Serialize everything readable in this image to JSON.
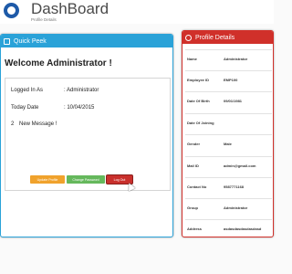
{
  "header": {
    "title": "DashBoard",
    "subtitle": "Profile Details"
  },
  "quick_peek": {
    "title": "Quick Peek",
    "welcome": "Welcome Administrator !",
    "logged_in_label": "Logged In As",
    "logged_in_value": ": Administrator",
    "today_label": "Today Date",
    "today_value": ": 10/04/2015",
    "message_count": "2",
    "message_label": "New Message !",
    "buttons": {
      "update": "Update Profile",
      "password": "Change Password",
      "logout": "Log Out"
    },
    "colors": {
      "accent": "#2aa2d8",
      "update": "#f0a22c",
      "password": "#65b85c",
      "logout": "#c9302c"
    }
  },
  "profile": {
    "title": "Profile Details",
    "accent": "#d0302a",
    "rows": [
      {
        "key": "Name",
        "value": "Administrator"
      },
      {
        "key": "Employee ID",
        "value": "EMP100"
      },
      {
        "key": "Date Of Birth",
        "value": "09/01/1981"
      },
      {
        "key": "Date Of Joining",
        "value": ""
      },
      {
        "key": "Gender",
        "value": "Male"
      },
      {
        "key": "Mail ID",
        "value": "admin@gmail.com"
      },
      {
        "key": "Contact No",
        "value": "9587771168"
      },
      {
        "key": "Group",
        "value": "Administrator"
      },
      {
        "key": "Address",
        "value": "asdasdasdasdasdasd"
      }
    ]
  },
  "icons": {
    "logo": "dashboard-logo-icon",
    "quick_peek": "panel-icon",
    "profile": "profile-icon",
    "cursor": "mouse-cursor-icon"
  }
}
